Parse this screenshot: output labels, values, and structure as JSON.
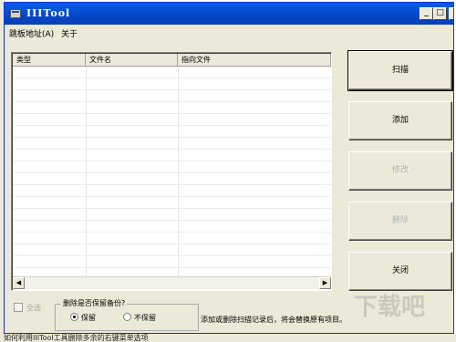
{
  "window": {
    "title": "IIITool"
  },
  "menu": {
    "items": [
      "跳板地址(A)",
      "关于"
    ]
  },
  "list": {
    "columns": [
      "类型",
      "文件名",
      "指向文件"
    ],
    "rows": []
  },
  "buttons": {
    "scan": "扫描",
    "add": "添加",
    "edit": "修改",
    "delete": "删除",
    "close": "关闭"
  },
  "select_all": {
    "label": "全选",
    "checked": false
  },
  "backup": {
    "title": "删除是否保留备份?",
    "option_keep": "保留",
    "option_nokeep": "不保留",
    "selected": "保留"
  },
  "hint": "添加或删除扫描记录后，将会替换原有项目。",
  "taskbar_text": "如何利用IIITool工具删除多余的右键菜单选项",
  "watermark": "下载吧",
  "colors": {
    "titlebar": "#0446c8",
    "face": "#ece9d8"
  }
}
